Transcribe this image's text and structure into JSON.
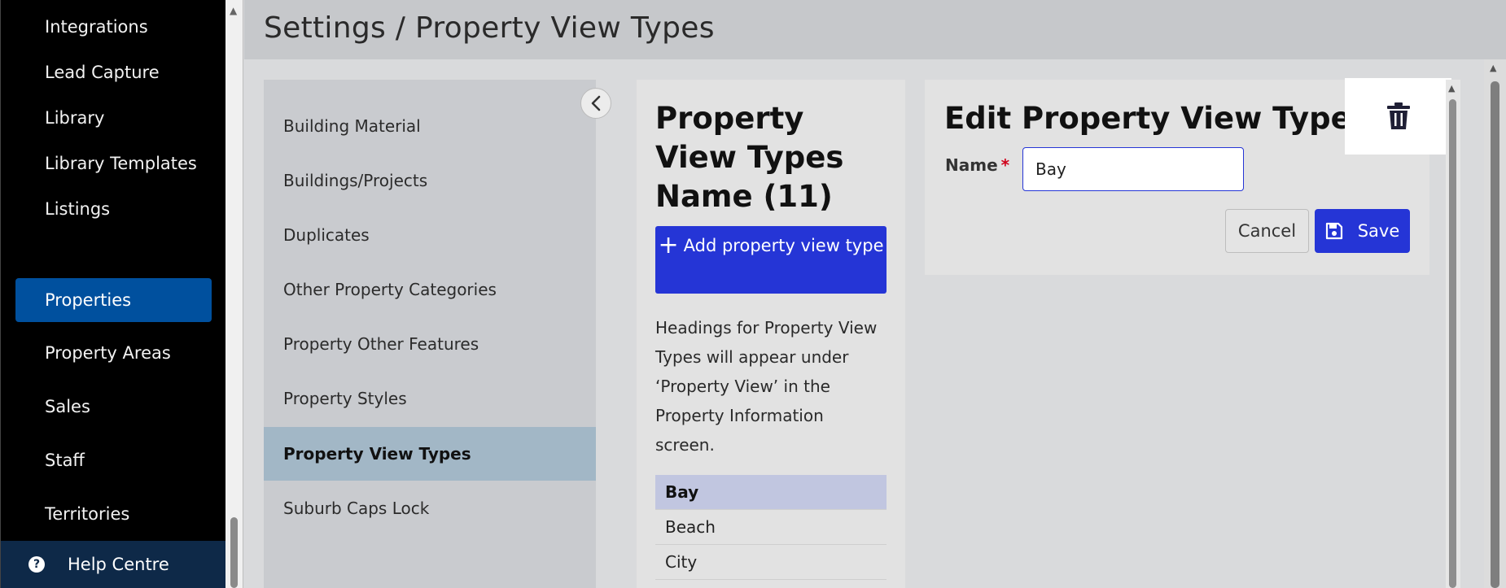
{
  "nav": {
    "items": [
      {
        "label": "Integrations"
      },
      {
        "label": "Lead Capture"
      },
      {
        "label": "Library"
      },
      {
        "label": "Library Templates"
      },
      {
        "label": "Listings"
      },
      {
        "label": "Properties"
      },
      {
        "label": "Property Areas"
      },
      {
        "label": "Sales"
      },
      {
        "label": "Staff"
      },
      {
        "label": "Territories"
      }
    ],
    "active": "Properties",
    "help_label": "Help Centre",
    "help_icon": "question-circle-icon"
  },
  "header": {
    "title": "Settings / Property View Types"
  },
  "settings": {
    "items": [
      {
        "label": "Building Material"
      },
      {
        "label": "Buildings/Projects"
      },
      {
        "label": "Duplicates"
      },
      {
        "label": "Other Property Categories"
      },
      {
        "label": "Property Other Features"
      },
      {
        "label": "Property Styles"
      },
      {
        "label": "Property View Types"
      },
      {
        "label": "Suburb Caps Lock"
      }
    ],
    "active": "Property View Types",
    "collapse_icon": "chevron-left-icon"
  },
  "list_panel": {
    "title": "Property View Types Name (11)",
    "add_button": "Add property view type",
    "description": "Headings for Property View Types will appear under ‘Property View’ in the Property Information screen.",
    "rows": [
      {
        "label": "Bay"
      },
      {
        "label": "Beach"
      },
      {
        "label": "City"
      }
    ],
    "selected": "Bay"
  },
  "edit_panel": {
    "title": "Edit Property View Types",
    "name_label": "Name",
    "required_mark": "*",
    "name_value": "Bay",
    "cancel_label": "Cancel",
    "save_label": "Save",
    "delete_icon": "trash-icon"
  },
  "colors": {
    "accent": "#2535d6",
    "nav_active": "#00509e",
    "nav_bg": "#000000",
    "help_bg": "#0e2948"
  }
}
